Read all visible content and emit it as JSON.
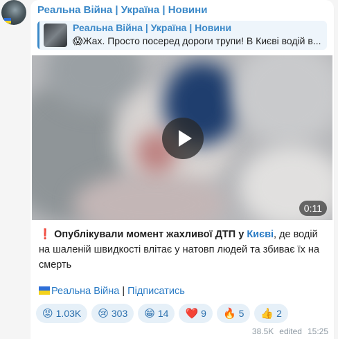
{
  "channel": {
    "name": "Реальна Війна | Україна | Новини"
  },
  "reply": {
    "name": "Реальна Війна | Україна | Новини",
    "text": "😱Жах. Просто посеред дороги трупи! В Києві водій в..."
  },
  "video": {
    "duration": "0:11"
  },
  "message": {
    "icon": "❗",
    "bold_text": "Опублікували момент жахливої ДТП у ",
    "city_link": "Києві",
    "text_rest": ", де водій на шаленій швидкості влітає у натовп людей та збиває їх на смерть"
  },
  "signature": {
    "channel_link": "Реальна Війна",
    "separator": " | ",
    "subscribe_link": "Підписатись"
  },
  "reactions": [
    {
      "emoji": "😡",
      "count": "1.03K"
    },
    {
      "emoji": "😢",
      "count": "303"
    },
    {
      "emoji": "😁",
      "count": "14"
    },
    {
      "emoji": "❤️",
      "count": "9"
    },
    {
      "emoji": "🔥",
      "count": "5"
    },
    {
      "emoji": "👍",
      "count": "2"
    }
  ],
  "footer": {
    "views": "38.5K",
    "edited": "edited",
    "time": "15:25"
  },
  "colors": {
    "accent": "#3a88c8",
    "link": "#2a7bc5",
    "reaction_bg": "#e6f0f8"
  }
}
